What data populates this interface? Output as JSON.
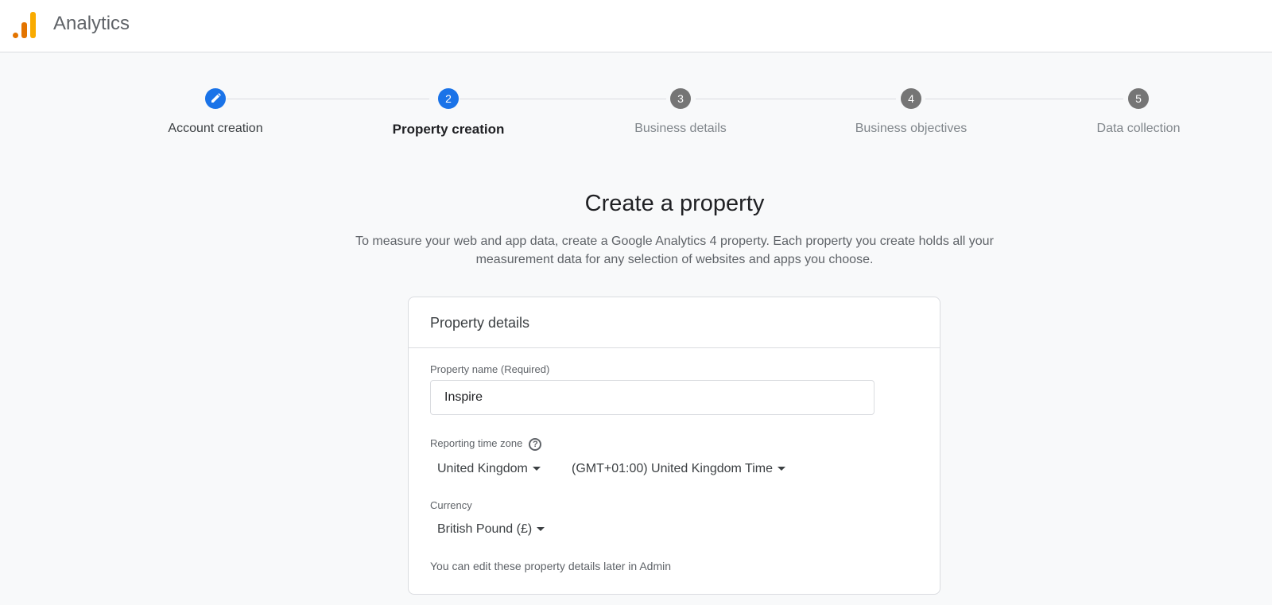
{
  "header": {
    "app_title": "Analytics",
    "logo_icon": "analytics-logo-icon"
  },
  "stepper": {
    "steps": [
      {
        "number": "",
        "label": "Account creation",
        "state": "done",
        "icon": "pencil-icon"
      },
      {
        "number": "2",
        "label": "Property creation",
        "state": "active"
      },
      {
        "number": "3",
        "label": "Business details",
        "state": "todo"
      },
      {
        "number": "4",
        "label": "Business objectives",
        "state": "todo"
      },
      {
        "number": "5",
        "label": "Data collection",
        "state": "todo"
      }
    ]
  },
  "page": {
    "title": "Create a property",
    "description": "To measure your web and app data, create a Google Analytics 4 property. Each property you create holds all your measurement data for any selection of websites and apps you choose."
  },
  "card": {
    "header": "Property details",
    "property_name_label": "Property name (Required)",
    "property_name_value": "Inspire",
    "timezone_label": "Reporting time zone",
    "timezone_help_icon": "help-circle-icon",
    "country_value": "United Kingdom",
    "timezone_value": "(GMT+01:00) United Kingdom Time",
    "currency_label": "Currency",
    "currency_value": "British Pound (£)",
    "note": "You can edit these property details later in Admin"
  },
  "colors": {
    "accent": "#1a73e8",
    "logo_orange": "#f9ab00",
    "logo_dark_orange": "#e37400",
    "step_inactive": "#757575"
  }
}
